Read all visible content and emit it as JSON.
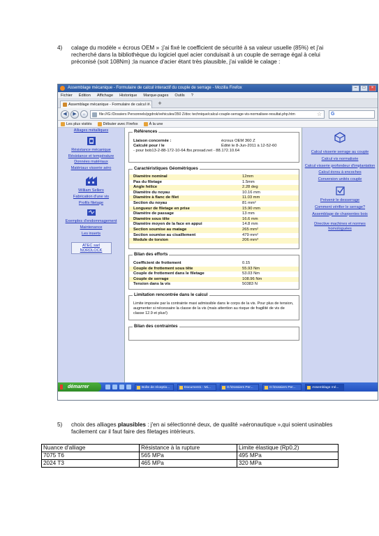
{
  "paragraph4": {
    "number": "4)",
    "text": "calage du modèle « écrous OEM » :j'ai fixé le coefficient de sécurité à sa valeur usuelle (85%) et j'ai recherché dans la bibliothèque du logiciel quel acier conduisait à un couple de serrage égal à celui préconisé (soit 108Nm) ;la nuance d'acier étant très plausible, j'ai validé le calage :"
  },
  "screenshot": {
    "window_title": "Assemblage mécanique - Formulaire de calcul interactif du couple de serrage - Mozilla Firefox",
    "menu": [
      "Fichier",
      "Édition",
      "Affichage",
      "Historique",
      "Marque-pages",
      "Outils",
      "?"
    ],
    "tab_title": "Assemblage mécanique - Formulaire de calcul i...",
    "url": "file:///G:/Dossiers Personnels/pgdrok/vehicules/350 Z/doc technique/calcul-couple-serrage-vis-normalisee-resultat.php.htm",
    "bookmarks": [
      "Les plus visités",
      "Débuter avec Firefox",
      "À la une"
    ],
    "left_links": [
      "Alliages métalliques",
      "Résistance mécanique",
      "Résistance et température",
      "Données matériaux",
      "Matériaux visserie aéro",
      "William Sellers",
      "Fabrication d'une vis",
      "Profils filetage",
      "Exemples d'endommagement",
      "Maintenance",
      "Les inserts",
      "ATEC sarl NORDLOCK"
    ],
    "right_links": [
      "Calcul visserie serrage au couple",
      "Calcul vis normalisée",
      "Calcul visserie profondeur d'implantation",
      "Calcul écrou à encoches",
      "Conversion unités couple",
      "Prévenir le desserrage",
      "Comment vérifier le serrage?",
      "Assemblage de charpentes bois",
      "Directive machines et normes homologuées"
    ],
    "references": {
      "legend": "Références",
      "rows": [
        {
          "k": "Liaison concernée :",
          "v": "écrous OEM 360 Z"
        },
        {
          "k": "Calculé pour / le",
          "v": "Édité le 8-Jun-2011 à 12-52-60"
        },
        {
          "k": "",
          "v": "- pour bob13-2-88-172-10-64.fbx.proxad.net - 88.172.10.64"
        }
      ]
    },
    "geometry": {
      "legend": "Caractéristiques Géométriques",
      "rows": [
        {
          "k": "Diamètre nominal",
          "v": "12mm"
        },
        {
          "k": "Pas du filetage",
          "v": "1.5mm"
        },
        {
          "k": "Angle hélice",
          "v": "2.28 deg"
        },
        {
          "k": "Diamètre du noyau",
          "v": "10.16 mm"
        },
        {
          "k": "Diamètre à flanc de filet",
          "v": "11.03 mm"
        },
        {
          "k": "Section du noyau",
          "v": "81 mm²"
        },
        {
          "k": "Longueur de filetage en prise",
          "v": "15.90 mm"
        },
        {
          "k": "Diamètre de passage",
          "v": "13 mm"
        },
        {
          "k": "Diamètre sous tête",
          "v": "16.6 mm"
        },
        {
          "k": "Diamètre moyen de la face en appui",
          "v": "14.8 mm"
        },
        {
          "k": "Section soumise au matage",
          "v": "265 mm²"
        },
        {
          "k": "Section soumise au cisaillement",
          "v": "479 mm²"
        },
        {
          "k": "Module de torsion",
          "v": "206 mm³"
        }
      ]
    },
    "forces": {
      "legend": "Bilan des efforts",
      "rows": [
        {
          "k": "Coefficient de frottement",
          "v": "0.15"
        },
        {
          "k": "Couple de frottement sous tête",
          "v": "55.93 Nm"
        },
        {
          "k": "Couple de frottement dans le filetage",
          "v": "53.03 Nm"
        },
        {
          "k": "Couple de serrage",
          "v": "108.96 Nm"
        },
        {
          "k": "Tension dans la vis",
          "v": "50383 N"
        }
      ]
    },
    "limitation": {
      "legend": "Limitation rencontrée dans le calcul",
      "text": "Limite imposée par la contrainte maxi admissible dans le corps de la vis. Pour plus de tension, augmenter si nécessaire la classe de la vis (mais attention au risque de fragilité de vis de classe 12.9 et plus!)"
    },
    "stresses": {
      "legend": "Bilan des contraintes"
    },
    "taskbar": {
      "start": "démarrer",
      "items": [
        "Boîte de réceptio...",
        "Document1 - Mi...",
        "G:\\Dossiers Per...",
        "G:\\Dossiers Per...",
        "Assemblage mé..."
      ]
    }
  },
  "paragraph5": {
    "number": "5)",
    "lead": "choix des alliages ",
    "bold": "plausibles",
    "text": " : j'en ai sélectionné deux, de qualité »aéronautique »,qui soient usinables facilement car il faut faire des filetages intérieurs."
  },
  "alloy_table": {
    "headers": [
      "Nuance d'alliage",
      "Résistance à la rupture",
      "Limite élastique (Rp0,2)"
    ],
    "rows": [
      [
        "7075 T6",
        "565 MPa",
        "495 MPa"
      ],
      [
        "2024 T3",
        "465 MPa",
        "320 MPa"
      ]
    ]
  }
}
